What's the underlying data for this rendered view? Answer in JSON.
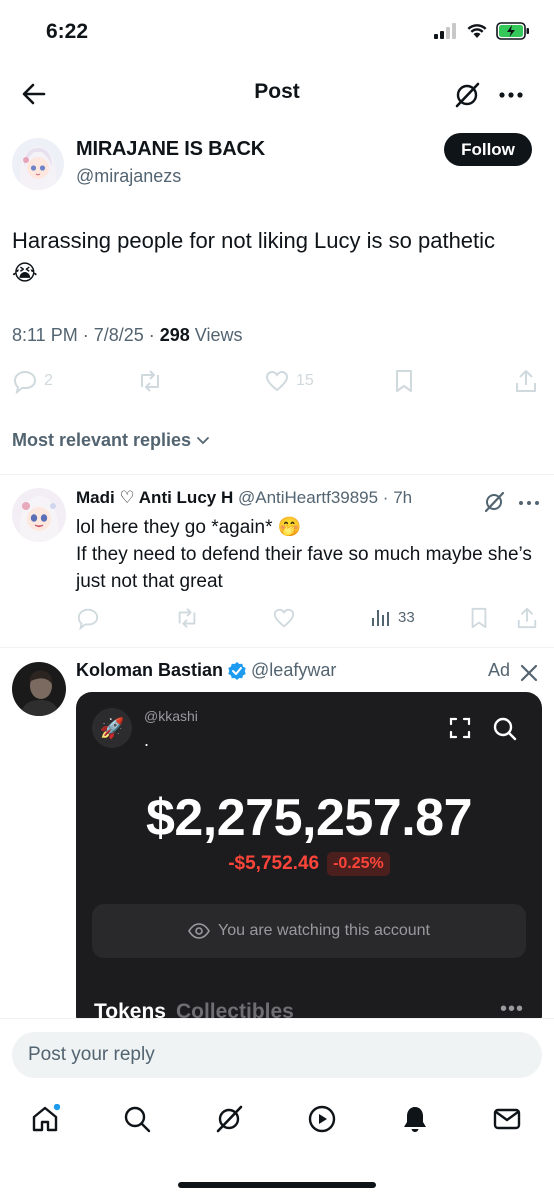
{
  "status_bar": {
    "time": "6:22"
  },
  "header": {
    "title": "Post"
  },
  "post": {
    "author_name": "MIRAJANE IS BACK",
    "author_handle": "@mirajanezs",
    "follow_label": "Follow",
    "text": "Harassing people for not liking Lucy is so pathetic 😭",
    "timestamp": "8:11 PM · 7/8/25 · ",
    "views_count": "298",
    "views_label": " Views",
    "replies_count": "2",
    "likes_count": "15"
  },
  "replies_filter": {
    "label": "Most relevant replies"
  },
  "reply": {
    "name": "Madi ♡ Anti Lucy H",
    "handle": "@AntiHeartf39895 · 7h",
    "line1": "lol here they go *again* 🤭",
    "line2": "If they need to defend their fave so much maybe she’s just not that great",
    "views": "33"
  },
  "ad": {
    "name": "Koloman Bastian",
    "handle": "@leafywar",
    "label": "Ad",
    "card": {
      "account_handle": "@kkashi",
      "account_dot": ".",
      "balance": "$2,275,257.87",
      "change": "-$5,752.46",
      "change_pct": "-0.25%",
      "watch_text": "You are watching this account",
      "tab_tokens": "Tokens",
      "tab_collectibles": "Collectibles"
    }
  },
  "composer": {
    "placeholder": "Post your reply"
  },
  "colors": {
    "verified": "#1d9bf0",
    "text_secondary": "#536471",
    "notification_dot": "#1d9bf0"
  }
}
